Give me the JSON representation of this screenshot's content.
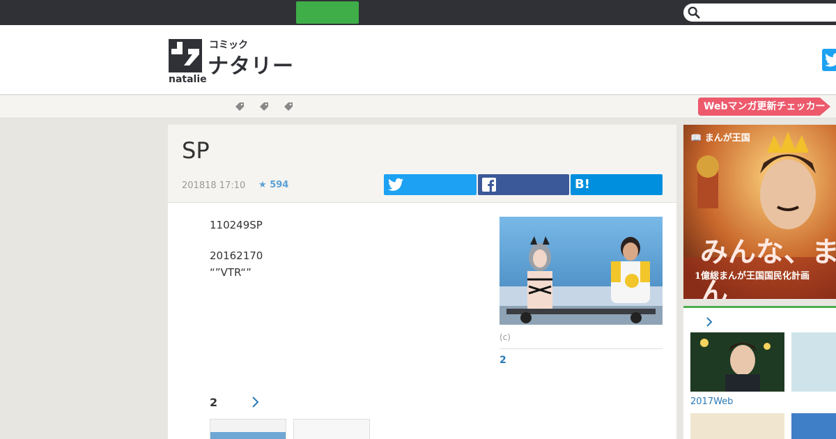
{
  "header": {
    "logo_small": "コミック",
    "logo_big": "ナタリー",
    "logo_natalie": "natalie"
  },
  "search": {
    "placeholder": ""
  },
  "navbar": {
    "webmanga_label": "Webマンガ更新チェッカー"
  },
  "article": {
    "title": "SP",
    "date": "201818 17:10",
    "star_count": "594",
    "share_hatena": "B!",
    "body_lines": [
      "110249SP",
      "20162170",
      "“”VTR“”"
    ],
    "photo_caption": "(c)",
    "photo_count": "2",
    "related_count": "2"
  },
  "sidebar": {
    "ad_label": "まんが王国",
    "ad_headline": "みんな、まん",
    "ad_subline": "1億総まんが王国国民化計画",
    "panel_caption": "2017Web"
  },
  "colors": {
    "topbar": "#2f3136",
    "green_button": "#3fae49",
    "twitter": "#1da1f2",
    "facebook": "#3b5998",
    "hatena": "#008fde",
    "webmanga": "#ec5a6c",
    "link": "#2a7ab5"
  }
}
